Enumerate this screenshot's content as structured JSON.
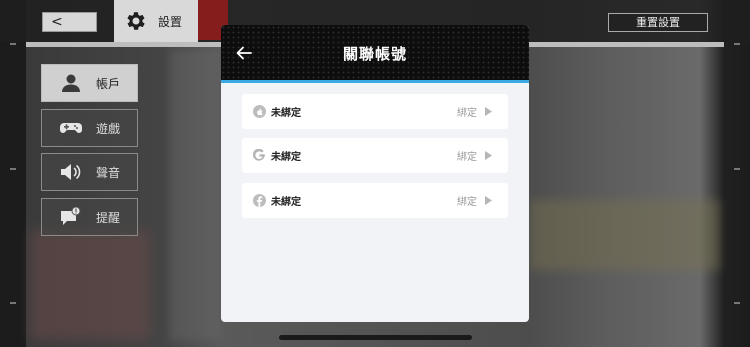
{
  "top_bar": {
    "back_label": "<",
    "settings_label": "設置",
    "reset_label": "重置設置"
  },
  "sidebar": {
    "items": [
      {
        "label": "帳戶",
        "icon": "person-icon",
        "active": true
      },
      {
        "label": "遊戲",
        "icon": "gamepad-icon",
        "active": false
      },
      {
        "label": "聲音",
        "icon": "speaker-icon",
        "active": false
      },
      {
        "label": "提醒",
        "icon": "notification-icon",
        "active": false
      }
    ]
  },
  "dialog": {
    "title": "關聯帳號",
    "back_icon": "arrow-left-icon",
    "accent_color": "#3aa9e6",
    "rows": [
      {
        "provider_icon": "apple-icon",
        "status": "未綁定",
        "action": "綁定"
      },
      {
        "provider_icon": "google-icon",
        "status": "未綁定",
        "action": "綁定"
      },
      {
        "provider_icon": "facebook-icon",
        "status": "未綁定",
        "action": "綁定"
      }
    ]
  }
}
